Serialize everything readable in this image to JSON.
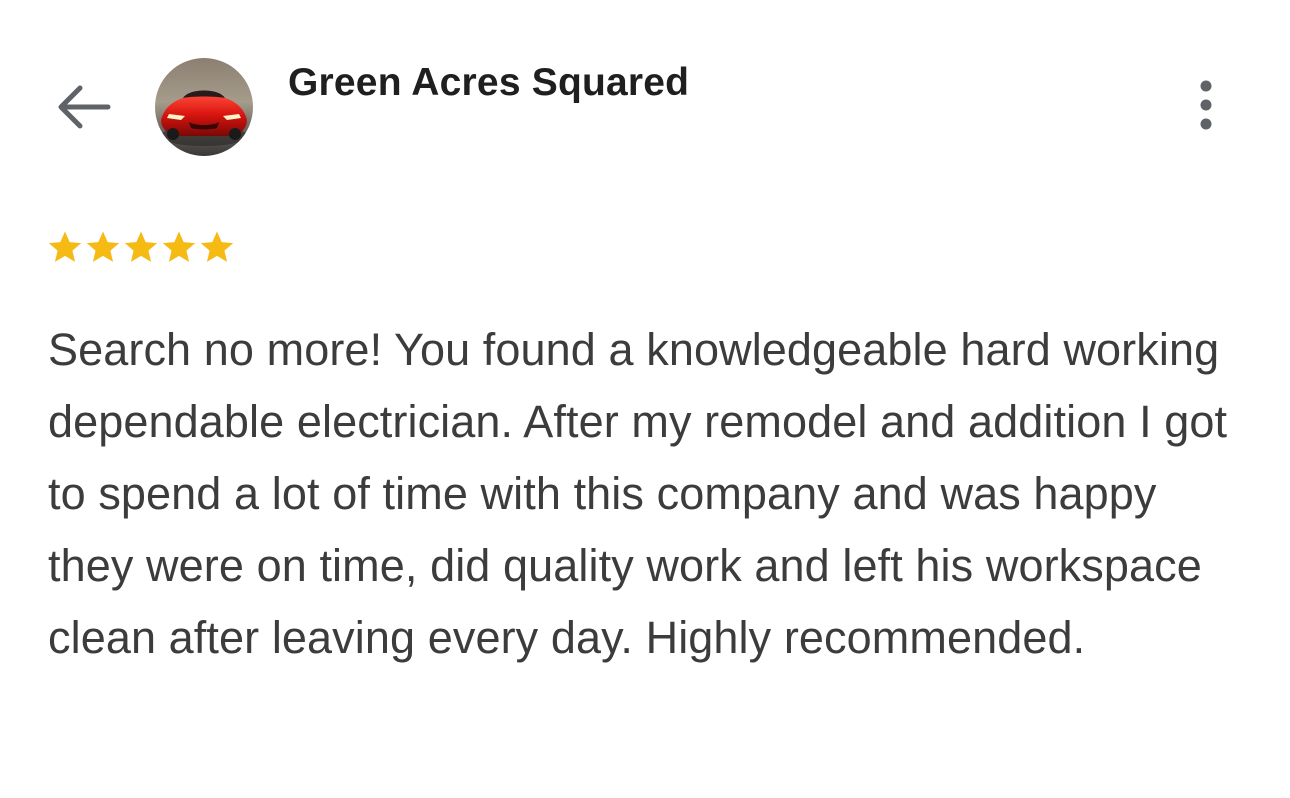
{
  "header": {
    "back_icon": "arrow-left-icon",
    "avatar_icon": "red-sports-car-avatar",
    "author_name": "Green Acres Squared",
    "more_icon": "more-vertical-icon"
  },
  "review": {
    "rating": 5,
    "rating_max": 5,
    "star_color": "#F5BA14",
    "text": "Search no more! You found a knowledgeable hard working dependable electrician. After my remodel and addition I got to spend a lot of time with this company and was happy they were on time, did quality work and left his workspace clean after leaving every day. Highly recommended."
  }
}
